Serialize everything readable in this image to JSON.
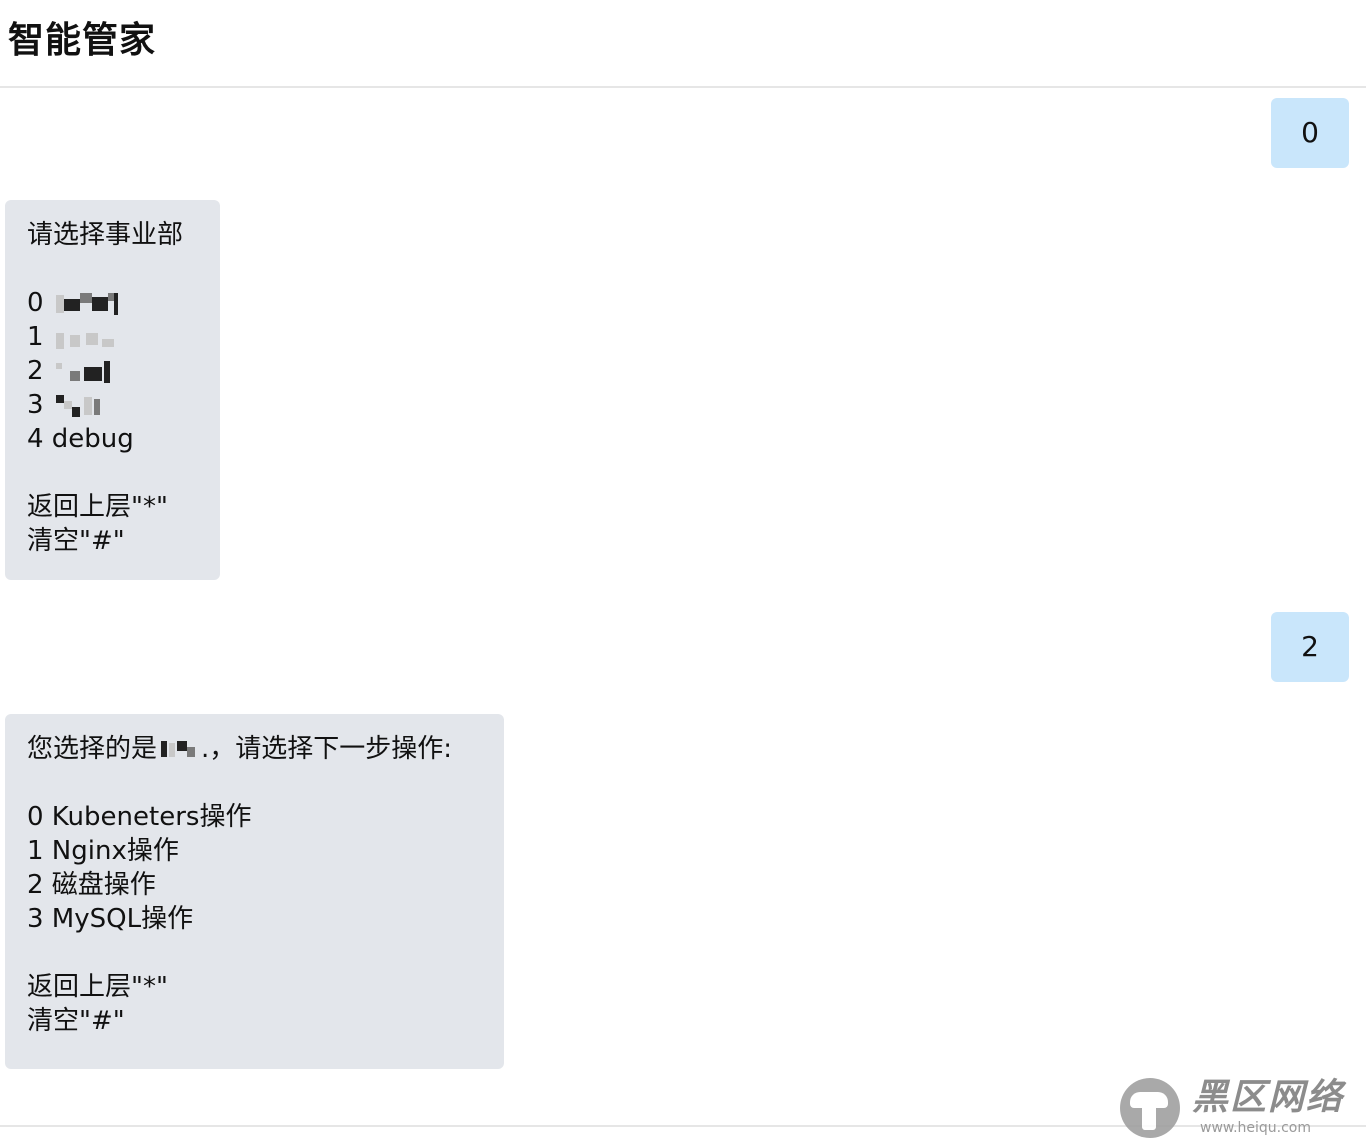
{
  "header": {
    "title": "智能管家"
  },
  "messages": {
    "user1": {
      "text": "0"
    },
    "bot1": {
      "prompt": "请选择事业部",
      "options": [
        "0 ",
        "1 ",
        "2 ",
        "3 ",
        "4 debug"
      ],
      "back": "返回上层\"*\"",
      "clear": "清空\"#\""
    },
    "user2": {
      "text": "2"
    },
    "bot2": {
      "prompt_before": "您选择的是",
      "prompt_after": ".，请选择下一步操作:",
      "options": [
        "0 Kubeneters操作",
        "1 Nginx操作",
        "2 磁盘操作",
        "3 MySQL操作"
      ],
      "back": "返回上层\"*\"",
      "clear": "清空\"#\""
    }
  },
  "watermark": {
    "brand": "黑区网络",
    "sub": "www.heiqu.com"
  },
  "colors": {
    "user_bubble": "#c9e6fb",
    "bot_bubble": "#e3e6eb",
    "divider": "#e6e6e6"
  }
}
